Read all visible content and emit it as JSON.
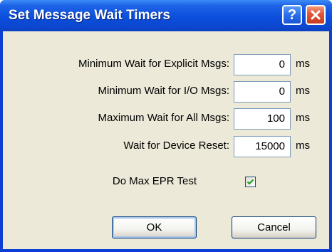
{
  "window": {
    "title": "Set Message Wait Timers",
    "help_icon": "help-icon",
    "close_icon": "close-icon"
  },
  "fields": [
    {
      "label": "Minimum Wait for Explicit Msgs:",
      "value": "0",
      "unit": "ms"
    },
    {
      "label": "Minimum Wait for I/O Msgs:",
      "value": "0",
      "unit": "ms"
    },
    {
      "label": "Maximum Wait for All Msgs:",
      "value": "100",
      "unit": "ms"
    },
    {
      "label": "Wait for Device Reset:",
      "value": "15000",
      "unit": "ms"
    }
  ],
  "max_epr_test": {
    "label": "Do Max EPR Test",
    "checked": true
  },
  "buttons": {
    "ok": "OK",
    "cancel": "Cancel"
  },
  "colors": {
    "titlebar": "#0b4fdc",
    "client_bg": "#ece9d8",
    "close_button": "#e2563a",
    "field_border": "#7f9db9"
  }
}
